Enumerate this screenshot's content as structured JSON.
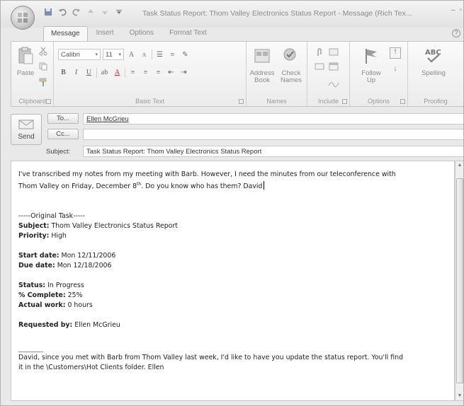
{
  "window": {
    "title": "Task Status Report: Thom Valley Electronics Status Report - Message (Rich Tex...",
    "controls": [
      "–",
      "▫",
      "✕"
    ]
  },
  "quick_access": [
    "save-icon",
    "undo-icon",
    "redo-icon",
    "up-icon",
    "down-icon",
    "customize-icon"
  ],
  "tabs": [
    {
      "label": "Message",
      "active": true
    },
    {
      "label": "Insert",
      "active": false
    },
    {
      "label": "Options",
      "active": false
    },
    {
      "label": "Format Text",
      "active": false
    }
  ],
  "ribbon": {
    "clipboard": {
      "label": "Clipboard",
      "paste": "Paste"
    },
    "basic_text": {
      "label": "Basic Text",
      "font": "Calibri",
      "size": "11"
    },
    "names": {
      "label": "Names",
      "address_book_1": "Address",
      "address_book_2": "Book",
      "check_names_1": "Check",
      "check_names_2": "Names"
    },
    "include": {
      "label": "Include"
    },
    "options": {
      "label": "Options",
      "follow_up_1": "Follow",
      "follow_up_2": "Up"
    },
    "proofing": {
      "label": "Proofing",
      "spelling": "Spelling"
    }
  },
  "header": {
    "send": "Send",
    "to_label": "To...",
    "to_value": "Ellen McGrieu",
    "cc_label": "Cc...",
    "cc_value": "",
    "subject_label": "Subject:",
    "subject_value": "Task Status Report: Thom Valley Electronics Status Report"
  },
  "body": {
    "intro_1": "I've transcribed my notes from my meeting with Barb. However, I need the minutes from our teleconference with",
    "intro_2a": "Thom Valley on Friday, December 8",
    "intro_2_sup": "th",
    "intro_2b": ". Do you know who has them? David",
    "original": "-----Original Task-----",
    "subject_label": "Subject:",
    "subject_value": "Thom Valley Electronics Status Report",
    "priority_label": "Priority:",
    "priority_value": "High",
    "start_label": "Start date:",
    "start_value": "Mon 12/11/2006",
    "due_label": "Due date:",
    "due_value": "Mon 12/18/2006",
    "status_label": "Status:",
    "status_value": "In Progress",
    "complete_label": "% Complete:",
    "complete_value": "25%",
    "actual_label": "Actual work:",
    "actual_value": "0 hours",
    "requested_label": "Requested by:",
    "requested_value": "Ellen McGrieu",
    "divider": "__________",
    "closing_1": "David, since you met with Barb from Thom Valley last week, I'd like to have you update the status report. You'll find",
    "closing_2": "it in the \\Customers\\Hot Clients  folder. Ellen"
  }
}
